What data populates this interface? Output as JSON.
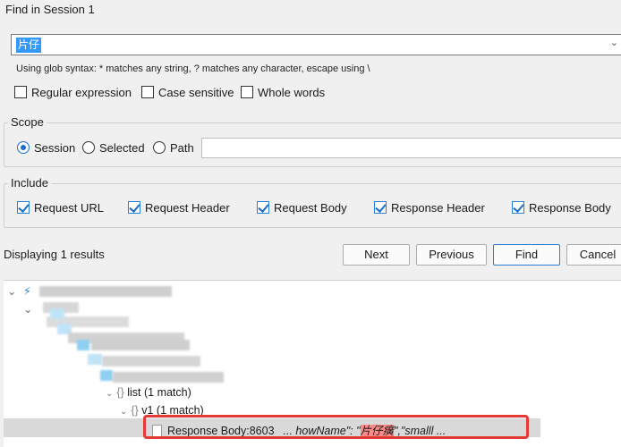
{
  "window": {
    "title": "Find in Session 1"
  },
  "search": {
    "value": "片仔",
    "hint": "Using glob syntax: * matches any string, ? matches any character, escape using \\"
  },
  "options": [
    {
      "label": "Regular expression",
      "checked": false
    },
    {
      "label": "Case sensitive",
      "checked": false
    },
    {
      "label": "Whole words",
      "checked": false
    }
  ],
  "scope": {
    "title": "Scope",
    "radios": [
      {
        "label": "Session",
        "checked": true
      },
      {
        "label": "Selected",
        "checked": false
      },
      {
        "label": "Path",
        "checked": false
      }
    ],
    "path_value": ""
  },
  "include": {
    "title": "Include",
    "items": [
      {
        "label": "Request URL",
        "checked": true
      },
      {
        "label": "Request Header",
        "checked": true
      },
      {
        "label": "Request Body",
        "checked": true
      },
      {
        "label": "Response Header",
        "checked": true
      },
      {
        "label": "Response Body",
        "checked": true
      }
    ]
  },
  "results": {
    "label": "Displaying 1 results"
  },
  "buttons": {
    "next": "Next",
    "previous": "Previous",
    "find": "Find",
    "cancel": "Cancel"
  },
  "tree": {
    "list_node": "list (1 match)",
    "v1_node": "v1 (1 match)",
    "match_label": "Response Body:8603",
    "snippet_pre": "... howName\": \"",
    "snippet_hl": "片仔癀",
    "snippet_post": "\",\"smalll ...",
    "colors": {
      "selection": "#d9d9d9",
      "highlight": "#ff8a8a",
      "outline": "#e53935"
    }
  }
}
